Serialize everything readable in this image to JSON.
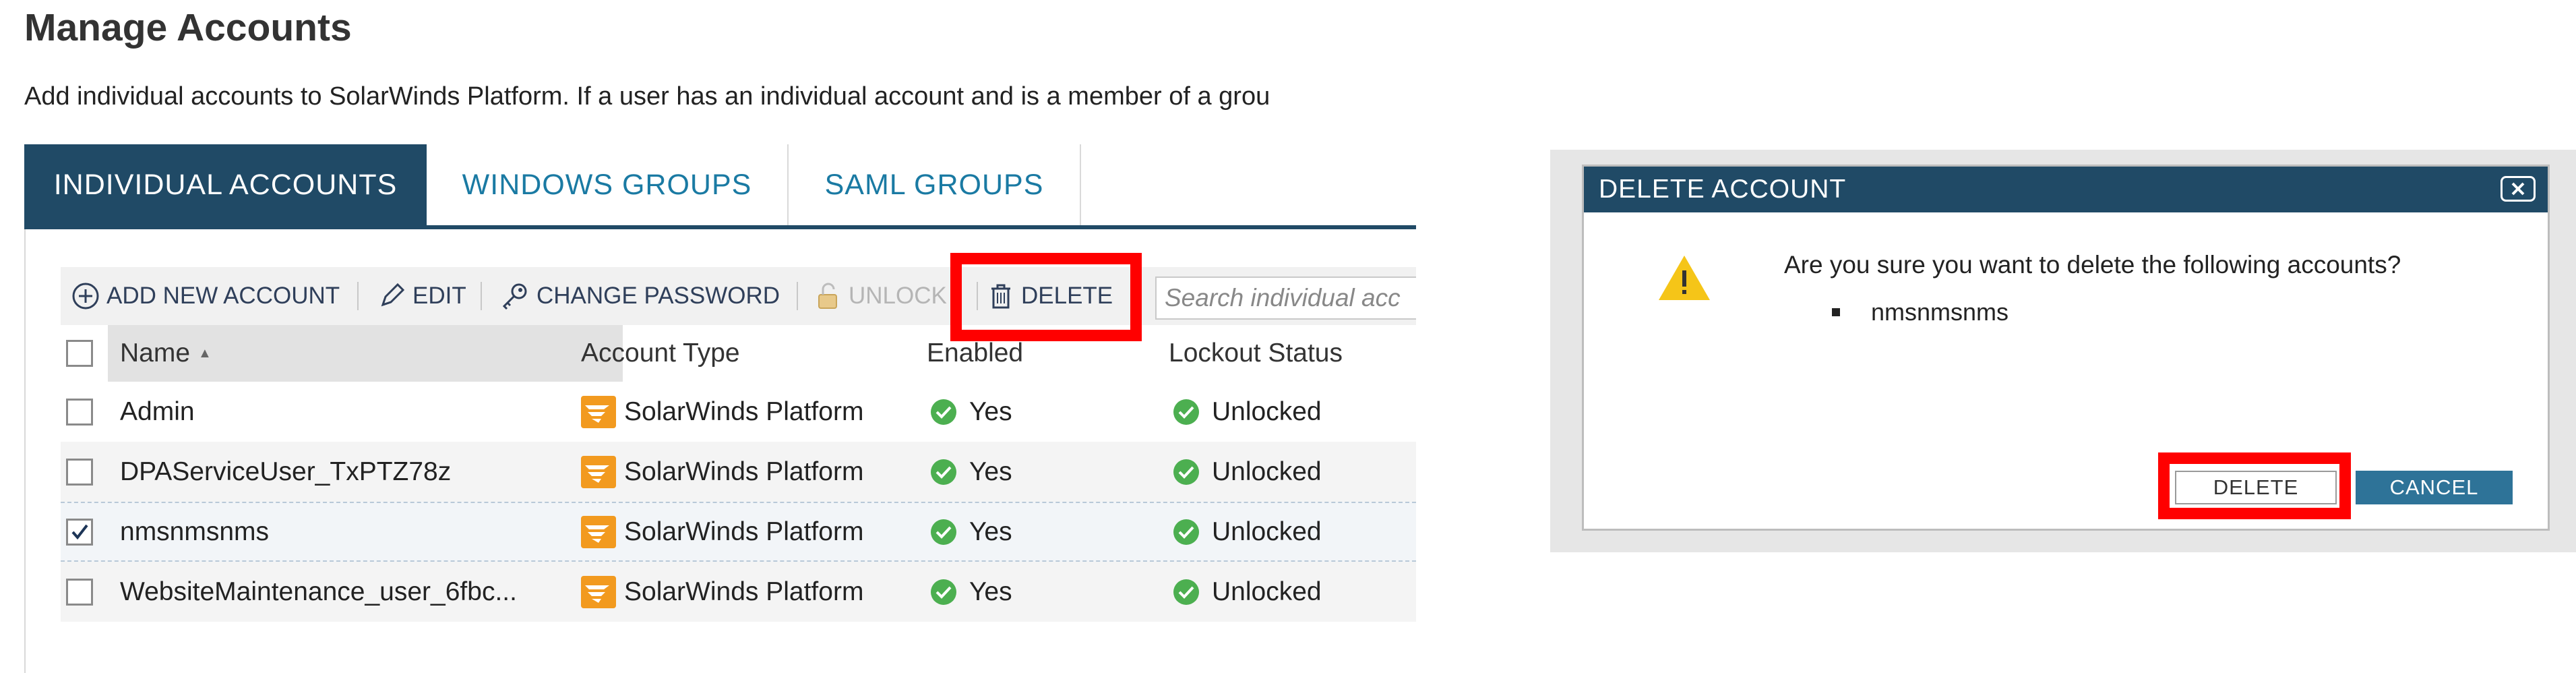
{
  "page": {
    "title": "Manage Accounts",
    "intro": "Add individual accounts to SolarWinds Platform. If a user has an individual account and is a member of a grou"
  },
  "tabs": [
    {
      "label": "INDIVIDUAL ACCOUNTS",
      "active": true
    },
    {
      "label": "WINDOWS GROUPS",
      "active": false
    },
    {
      "label": "SAML GROUPS",
      "active": false
    }
  ],
  "toolbar": {
    "add_label": "ADD NEW ACCOUNT",
    "edit_label": "EDIT",
    "change_password_label": "CHANGE PASSWORD",
    "unlock_label": "UNLOCK",
    "delete_label": "DELETE",
    "search_placeholder": "Search individual acc"
  },
  "grid": {
    "columns": [
      "Name",
      "Account Type",
      "Enabled",
      "Lockout Status"
    ],
    "sort_indicator": "▲",
    "rows": [
      {
        "name": "Admin",
        "type": "SolarWinds Platform",
        "enabled": "Yes",
        "lockout": "Unlocked",
        "checked": false
      },
      {
        "name": "DPAServiceUser_TxPTZ78z",
        "type": "SolarWinds Platform",
        "enabled": "Yes",
        "lockout": "Unlocked",
        "checked": false
      },
      {
        "name": "nmsnmsnms",
        "type": "SolarWinds Platform",
        "enabled": "Yes",
        "lockout": "Unlocked",
        "checked": true
      },
      {
        "name": "WebsiteMaintenance_user_6fbc...",
        "type": "SolarWinds Platform",
        "enabled": "Yes",
        "lockout": "Unlocked",
        "checked": false
      }
    ]
  },
  "dialog": {
    "title": "DELETE ACCOUNT",
    "message": "Are you sure you want to delete the following accounts?",
    "accounts": [
      "nmsnmsnms"
    ],
    "delete_label": "DELETE",
    "cancel_label": "CANCEL"
  },
  "colors": {
    "header_navy": "#204a66",
    "link_blue": "#1a7aa3",
    "highlight_red": "#ff0000",
    "check_green": "#4caf50",
    "warning_yellow": "#f5c518",
    "cancel_blue": "#2e7398"
  },
  "icons": [
    "add-icon",
    "edit-pencil-icon",
    "key-icon",
    "unlock-icon",
    "trash-icon",
    "sort-ascending-icon",
    "solarwinds-icon",
    "check-circle-icon",
    "warning-icon",
    "close-icon",
    "checkmark-icon"
  ]
}
